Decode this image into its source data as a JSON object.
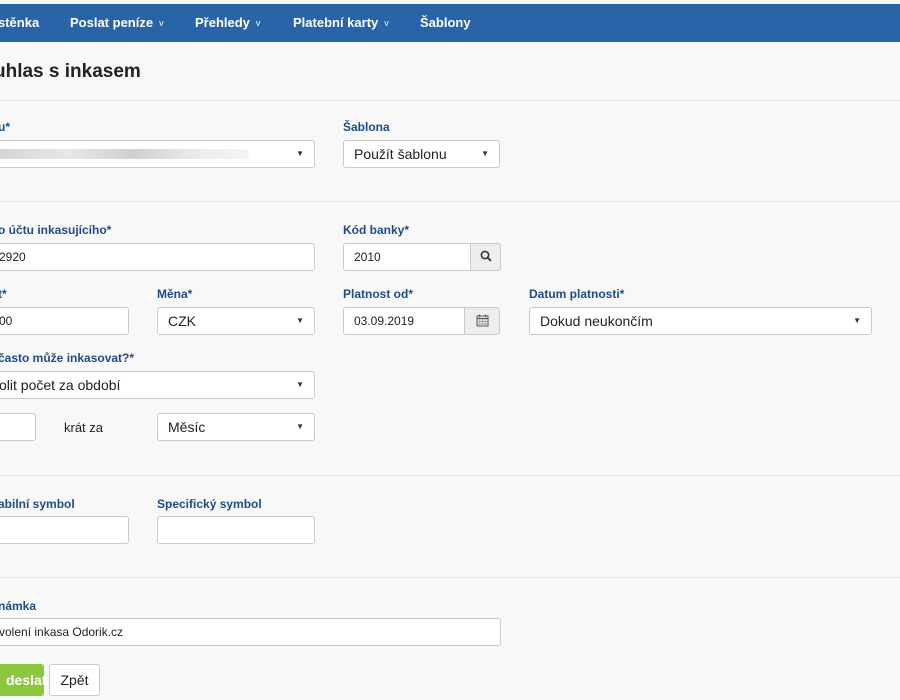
{
  "nav": {
    "items": [
      {
        "label": "stěnka",
        "caret": false
      },
      {
        "label": "Poslat peníze",
        "caret": true
      },
      {
        "label": "Přehledy",
        "caret": true
      },
      {
        "label": "Platební karty",
        "caret": true
      },
      {
        "label": "Šablony",
        "caret": false
      }
    ],
    "caret_symbol": "v"
  },
  "page": {
    "title": "uhlas s inkasem"
  },
  "form": {
    "account": {
      "label": "u*"
    },
    "template": {
      "label": "Šablona",
      "value": "Použít šablonu"
    },
    "creditor_account": {
      "label": "o účtu inkasujícího*",
      "value": "2920"
    },
    "bank_code": {
      "label": "Kód banky*",
      "value": "2010"
    },
    "amount": {
      "label": "t*",
      "value": "00"
    },
    "currency": {
      "label": "Měna*",
      "value": "CZK"
    },
    "valid_from": {
      "label": "Platnost od*",
      "value": "03.09.2019"
    },
    "valid_until": {
      "label": "Datum platnosti*",
      "value": "Dokud neukončím"
    },
    "frequency": {
      "label": "často může inkasovat?*",
      "value": "olit počet za období"
    },
    "times": {
      "label": "krát za",
      "value": ""
    },
    "period": {
      "value": "Měsíc"
    },
    "constant_symbol": {
      "label": "abilní symbol",
      "value": ""
    },
    "specific_symbol": {
      "label": "Specifický symbol",
      "value": ""
    },
    "note": {
      "label": "námka",
      "value": "volení inkasa Odorik.cz"
    }
  },
  "buttons": {
    "submit": "deslat",
    "back": "Zpět"
  },
  "colors": {
    "nav": "#2a64a8",
    "label": "#1e4c86",
    "primary_button": "#8dc63f"
  },
  "icons": {
    "dropdown": "chevron-down-icon",
    "bank_lookup": "search-icon",
    "date_picker": "calendar-icon"
  }
}
